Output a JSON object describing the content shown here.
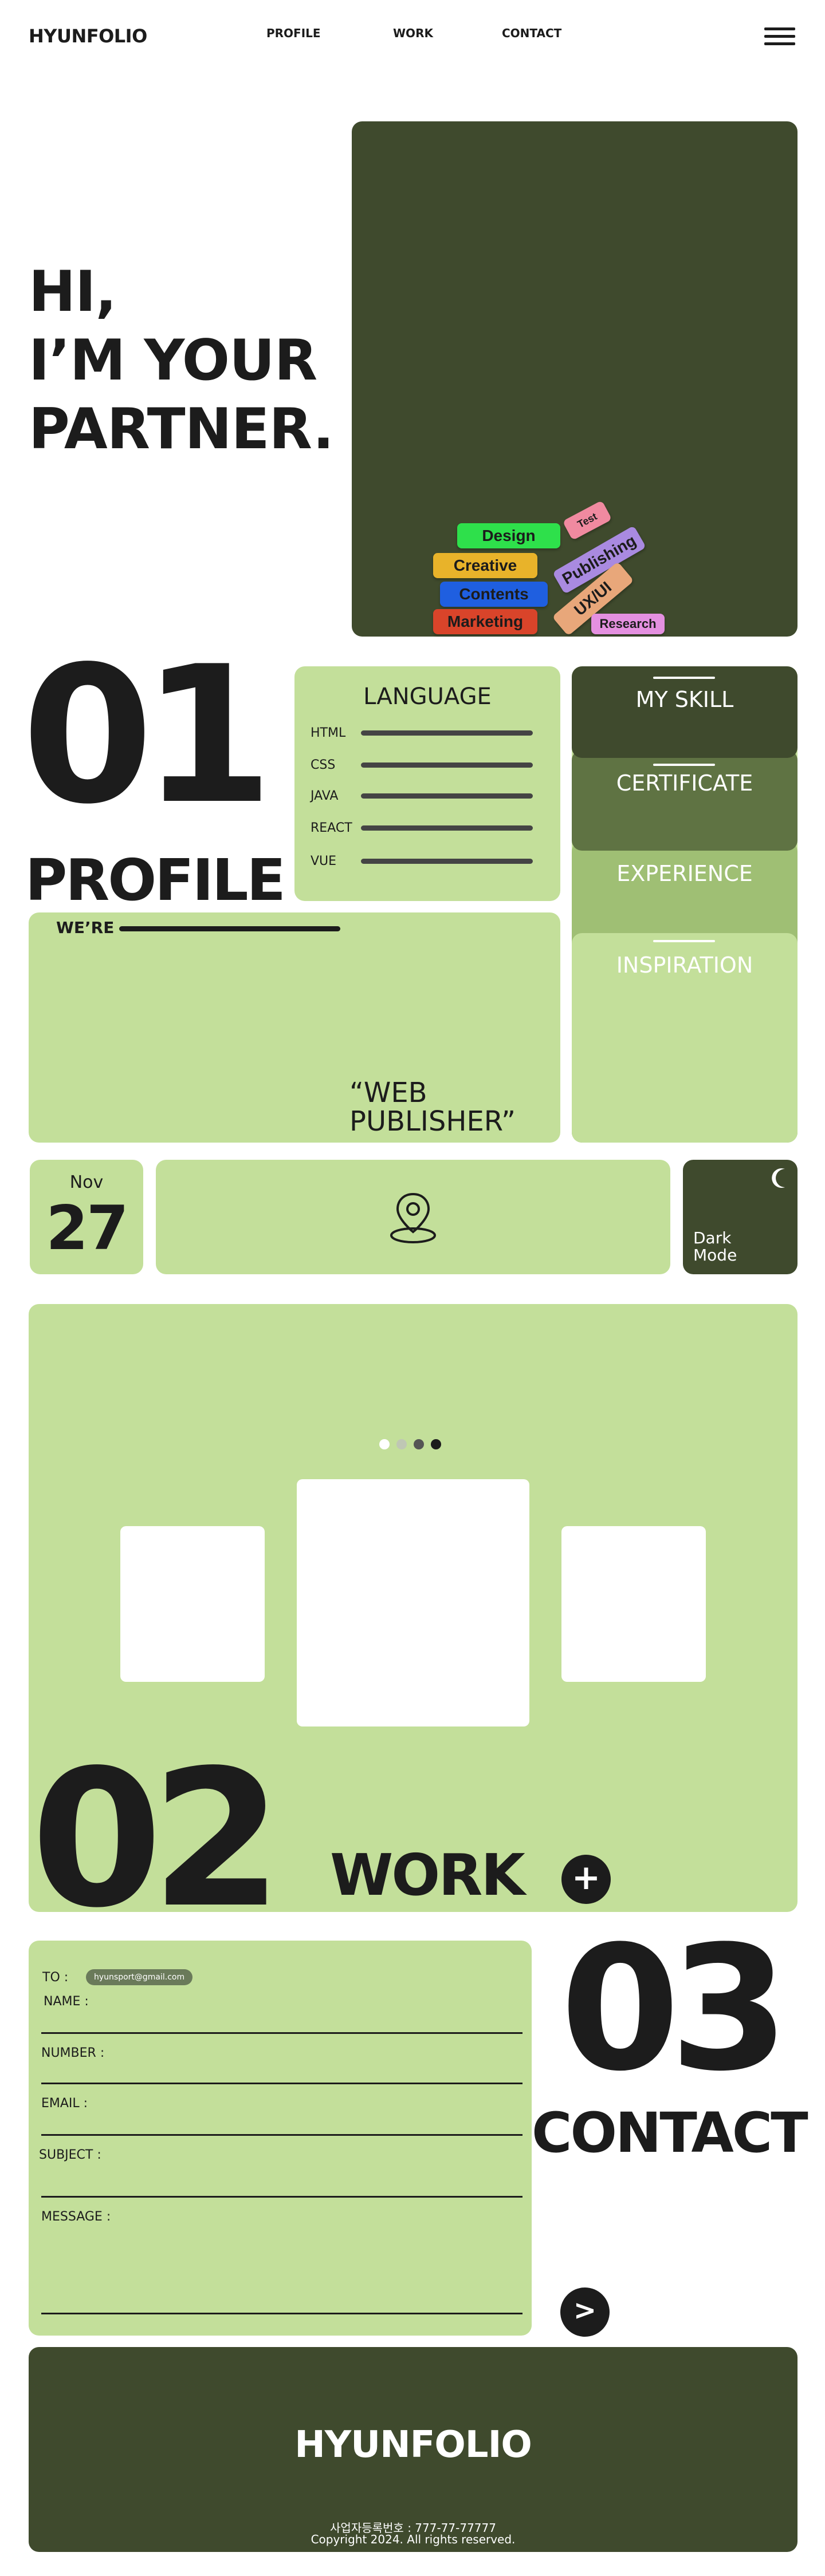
{
  "header": {
    "logo": "HYUNFOLIO",
    "nav": [
      "PROFILE",
      "WORK",
      "CONTACT"
    ]
  },
  "hero": {
    "lines": [
      "HI,",
      "I’M YOUR",
      "PARTNER."
    ],
    "tags": [
      "Design",
      "Creative",
      "Contents",
      "Marketing",
      "Test",
      "Publishing",
      "UX/UI",
      "Research"
    ]
  },
  "profile": {
    "number": "01",
    "title": "PROFILE",
    "language": {
      "title": "LANGUAGE",
      "items": [
        "HTML",
        "CSS",
        "JAVA",
        "REACT",
        "VUE"
      ]
    },
    "skills": [
      "MY SKILL",
      "CERTIFICATE",
      "EXPERIENCE",
      "INSPIRATION"
    ],
    "intro": {
      "label": "WE’RE",
      "quote_line1": "“WEB",
      "quote_line2": "PUBLISHER”"
    },
    "date": {
      "month": "Nov",
      "day": "27"
    },
    "dark_mode": {
      "line1": "Dark",
      "line2": "Mode"
    }
  },
  "work": {
    "number": "02",
    "title": "WORK",
    "add_label": "+"
  },
  "contact": {
    "number": "03",
    "title": "CONTACT",
    "to_label": "TO :",
    "to_email": "hyunsport@gmail.com",
    "fields": [
      "NAME :",
      "NUMBER :",
      "EMAIL :",
      "SUBJECT :",
      "MESSAGE :"
    ],
    "submit_label": ">"
  },
  "footer": {
    "logo": "HYUNFOLIO",
    "business_no": "사업자등록번호 : 777-77-77777",
    "copyright": "Copyright 2024. All rights reserved."
  },
  "colors": {
    "dark_olive": "#3f4a2d",
    "light_green": "#c3df9a",
    "mid_green": "#5f7343",
    "tag_design": "#2ee04b",
    "tag_creative": "#e8b32a",
    "tag_contents": "#1f5fe0",
    "tag_marketing": "#d9442a",
    "tag_test": "#f08aa0",
    "tag_publishing": "#a98ae0",
    "tag_uxui": "#e8a77a",
    "tag_research": "#e490e0"
  }
}
